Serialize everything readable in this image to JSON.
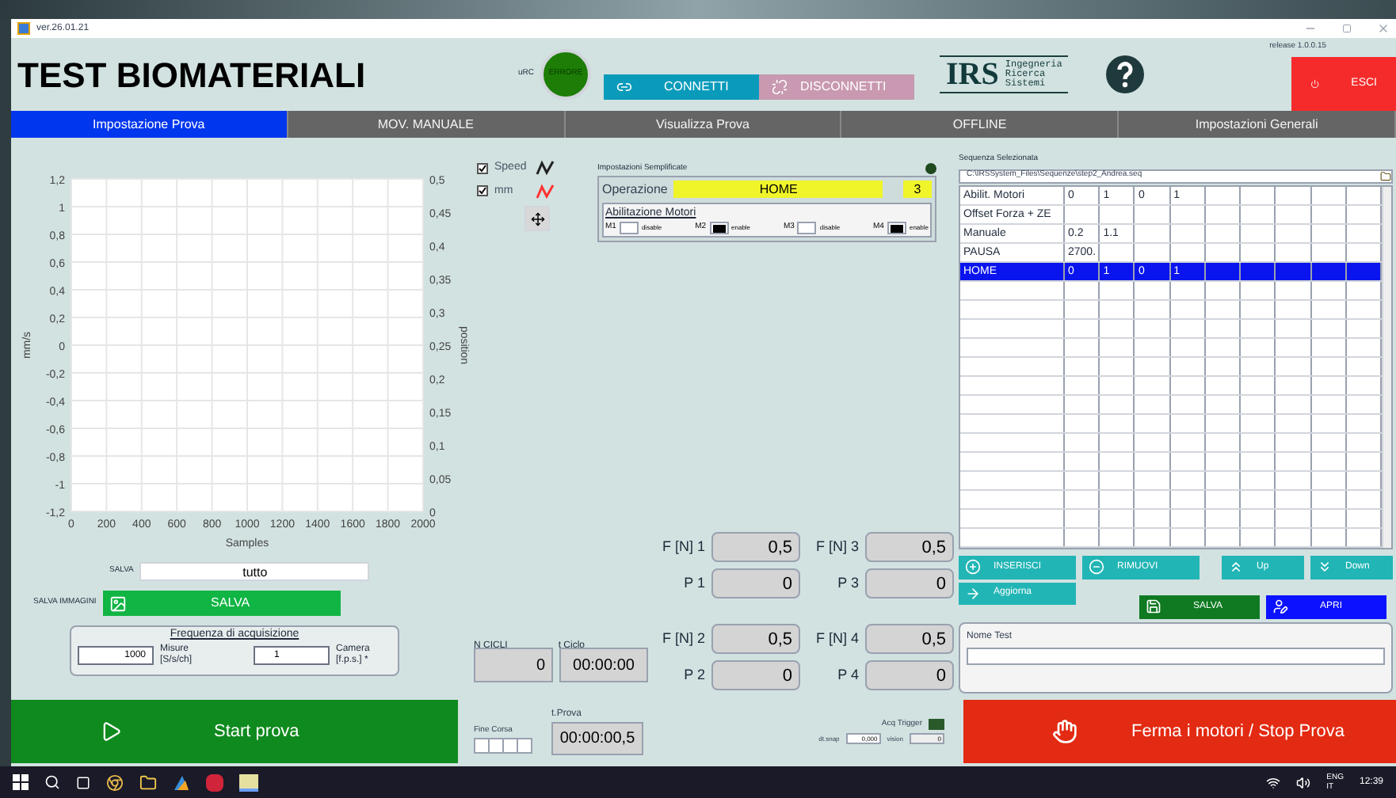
{
  "window": {
    "title": "ver.26.01.21"
  },
  "header": {
    "title": "TEST BIOMATERIALI",
    "status_label": "uRC",
    "status_led": {
      "text": "ERRORE",
      "on": true
    },
    "connect_button": "CONNETTI",
    "disconnect_button": "DISCONNETTI",
    "logo": {
      "mark": "IRS",
      "lines": [
        "Ingegneria",
        "Ricerca",
        "Sistemi"
      ]
    },
    "release": "release 1.0.0.15",
    "exit_button": "ESCI"
  },
  "tabs": [
    {
      "label": "Impostazione Prova",
      "selected": true
    },
    {
      "label": "MOV. MANUALE",
      "selected": false
    },
    {
      "label": "Visualizza Prova",
      "selected": false
    },
    {
      "label": "OFFLINE",
      "selected": false
    },
    {
      "label": "Impostazioni Generali",
      "selected": false
    }
  ],
  "chart": {
    "chart_data": {
      "type": "line",
      "grid": true,
      "xlabel": "Samples",
      "ylabel": "mm/s",
      "xlim": [
        0,
        2000
      ],
      "ylim": [
        -1.2,
        1.2
      ],
      "xticks": [
        0,
        200,
        400,
        600,
        800,
        1000,
        1200,
        1400,
        1600,
        1800,
        2000
      ],
      "yticks": [
        {
          "value": 1.2,
          "label": "1,2"
        },
        {
          "value": 1,
          "label": "1"
        },
        {
          "value": 0.8,
          "label": "0,8"
        },
        {
          "value": 0.6,
          "label": "0,6"
        },
        {
          "value": 0.4,
          "label": "0,4"
        },
        {
          "value": 0.2,
          "label": "0,2"
        },
        {
          "value": 0,
          "label": "0"
        },
        {
          "value": -0.2,
          "label": "-0,2"
        },
        {
          "value": -0.4,
          "label": "-0,4"
        },
        {
          "value": -0.6,
          "label": "-0,6"
        },
        {
          "value": -0.8,
          "label": "-0,8"
        },
        {
          "value": -1,
          "label": "-1"
        },
        {
          "value": -1.2,
          "label": "-1,2"
        }
      ]
    },
    "right_axis": {
      "label": "position",
      "ticks": [
        "0,5",
        "0,45",
        "0,4",
        "0,35",
        "0,3",
        "0,25",
        "0,2",
        "0,15",
        "0,1",
        "0,05",
        "0"
      ]
    },
    "legend": [
      {
        "label": "Speed",
        "checked": true,
        "color": "#222222"
      },
      {
        "label": "mm",
        "checked": true,
        "color": "#ff3333"
      }
    ]
  },
  "save": {
    "label": "SALVA",
    "value": "tutto"
  },
  "save_images": {
    "label": "SALVA IMMAGINI",
    "button": "SALVA"
  },
  "acquisition": {
    "title": "Frequenza di acquisizione",
    "fields": [
      {
        "value": "1000",
        "label": "Misure",
        "unit": "[S/s/ch]"
      },
      {
        "value": "1",
        "label": "Camera",
        "unit": "[f.p.s.] *"
      }
    ]
  },
  "simple_settings": {
    "title": "Impostazioni Semplificate",
    "led_on": false,
    "operation_label": "Operazione",
    "operation": "HOME",
    "step": "3",
    "motors_title": "Abilitazione Motori",
    "motors": [
      {
        "label": "M1",
        "enabled": false,
        "state": "disable"
      },
      {
        "label": "M2",
        "enabled": true,
        "state": "enable"
      },
      {
        "label": "M3",
        "enabled": false,
        "state": "disable"
      },
      {
        "label": "M4",
        "enabled": true,
        "state": "enable"
      }
    ]
  },
  "readouts": [
    {
      "label": "F [N] 1",
      "value": "0,5"
    },
    {
      "label": "F [N] 3",
      "value": "0,5"
    },
    {
      "label": "P 1",
      "value": "0"
    },
    {
      "label": "P 3",
      "value": "0"
    },
    {
      "label": "F [N] 2",
      "value": "0,5"
    },
    {
      "label": "F [N] 4",
      "value": "0,5"
    },
    {
      "label": "P 2",
      "value": "0"
    },
    {
      "label": "P 4",
      "value": "0"
    }
  ],
  "cycles": {
    "count_label": "N CICLI",
    "count": "0",
    "time_label": "t Ciclo",
    "time": "00:00:00"
  },
  "sequence": {
    "title": "Sequenza Selezionata",
    "path": "C:\\IRSSystem_Files\\Sequenze\\step2_Andrea.seq",
    "rows": [
      {
        "cells": [
          "Abilit. Motori",
          "0",
          "1",
          "0",
          "1"
        ],
        "selected": false
      },
      {
        "cells": [
          "Offset Forza + ZE"
        ],
        "selected": false
      },
      {
        "cells": [
          "Manuale",
          "0.2",
          "1.1"
        ],
        "selected": false
      },
      {
        "cells": [
          "PAUSA",
          "2700."
        ],
        "selected": false
      },
      {
        "cells": [
          "HOME",
          "0",
          "1",
          "0",
          "1"
        ],
        "selected": true
      }
    ],
    "buttons": [
      {
        "label": "INSERISCI",
        "kind": "plus"
      },
      {
        "label": "RIMUOVI",
        "kind": "minus"
      },
      {
        "label": "Up",
        "kind": "up"
      },
      {
        "label": "Down",
        "kind": "down"
      },
      {
        "label": "Aggiorna",
        "kind": "arrow"
      }
    ],
    "file_buttons": [
      {
        "label": "SALVA",
        "kind": "save"
      },
      {
        "label": "APRI",
        "kind": "open"
      }
    ],
    "name_label": "Nome Test"
  },
  "bottom": {
    "start": "Start prova",
    "limit_label": "Fine Corsa",
    "test_time_label": "t.Prova",
    "test_time": "00:00:00,5",
    "trigger_label": "Acq Trigger",
    "trigger_on": false,
    "snap_label": "dt.snap",
    "snap": "0,000",
    "vision_label": "vision",
    "vision": "0",
    "stop": "Ferma i motori / Stop Prova"
  },
  "taskbar": {
    "language": [
      "ENG",
      "IT"
    ],
    "time": "12:39"
  }
}
